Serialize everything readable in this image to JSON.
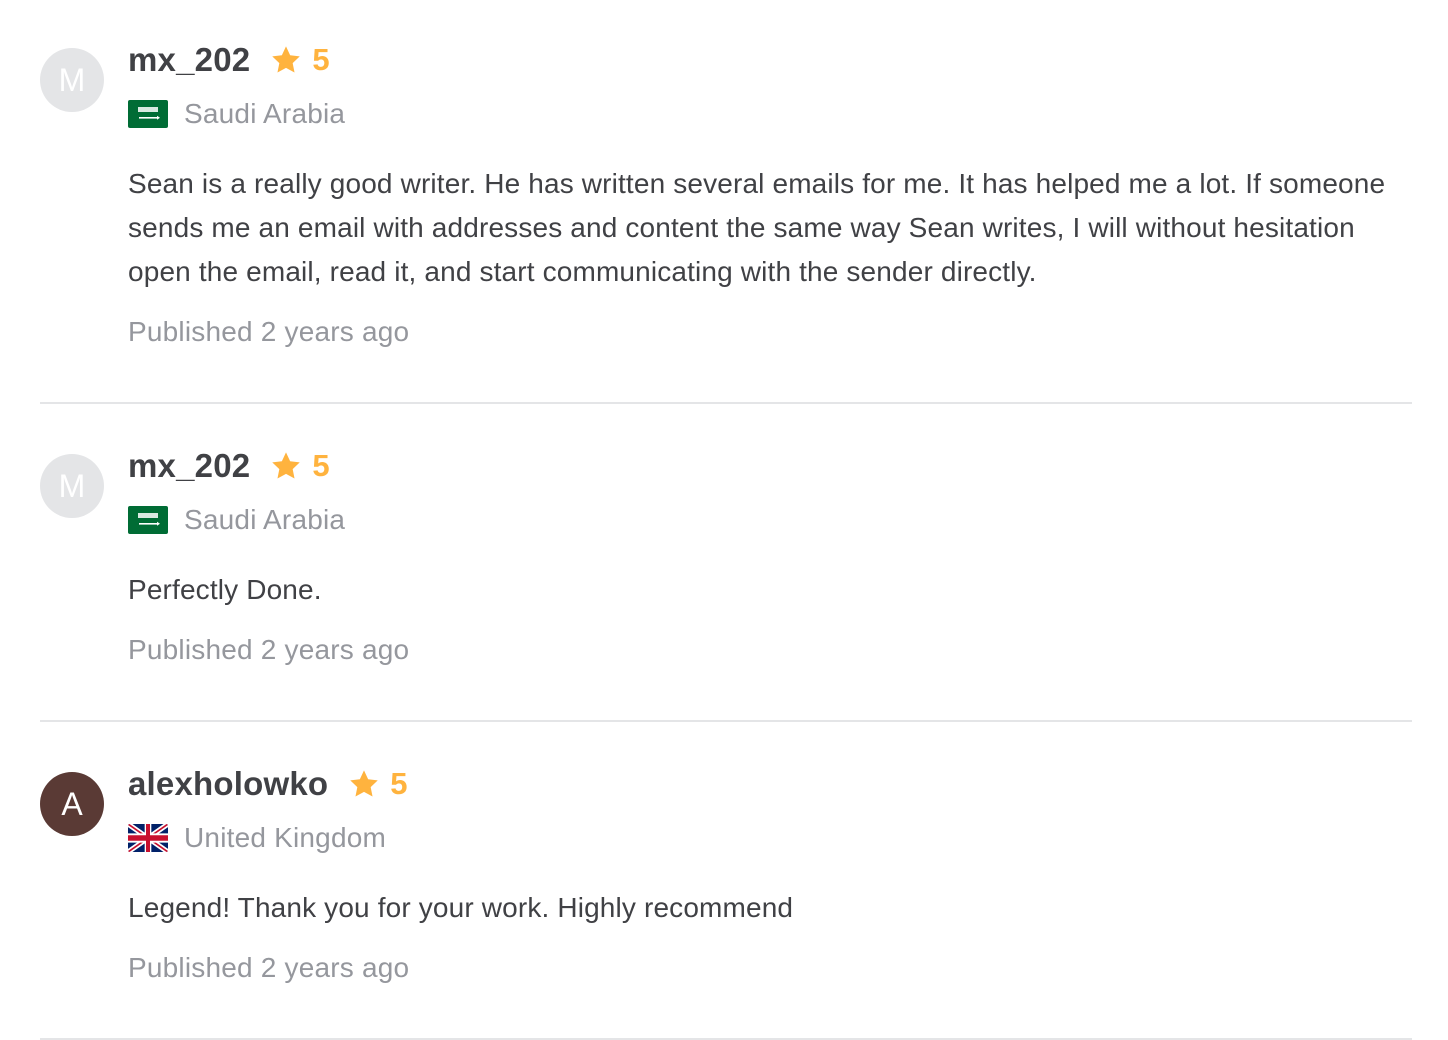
{
  "reviews": [
    {
      "avatar_initial": "M",
      "avatar_bg": "#e4e5e7",
      "avatar_fg": "#ffffff",
      "username": "mx_202",
      "rating": "5",
      "flag_icon": "saudi-arabia-flag-icon",
      "country": "Saudi Arabia",
      "text": "Sean is a really good writer. He has written several emails for me. It has helped me a lot. If someone sends me an email with addresses and content the same way Sean writes, I will without hesitation open the email, read it, and start communicating with the sender directly.",
      "published": "Published 2 years ago"
    },
    {
      "avatar_initial": "M",
      "avatar_bg": "#e4e5e7",
      "avatar_fg": "#ffffff",
      "username": "mx_202",
      "rating": "5",
      "flag_icon": "saudi-arabia-flag-icon",
      "country": "Saudi Arabia",
      "text": "Perfectly Done.",
      "published": "Published 2 years ago"
    },
    {
      "avatar_initial": "A",
      "avatar_bg": "#5a3a35",
      "avatar_fg": "#ffffff",
      "username": "alexholowko",
      "rating": "5",
      "flag_icon": "united-kingdom-flag-icon",
      "country": "United Kingdom",
      "text": "Legend! Thank you for your work. Highly recommend",
      "published": "Published 2 years ago"
    }
  ],
  "colors": {
    "star": "#ffb33e",
    "muted_text": "#95979d",
    "body_text": "#404145",
    "divider": "#e4e5e7"
  }
}
